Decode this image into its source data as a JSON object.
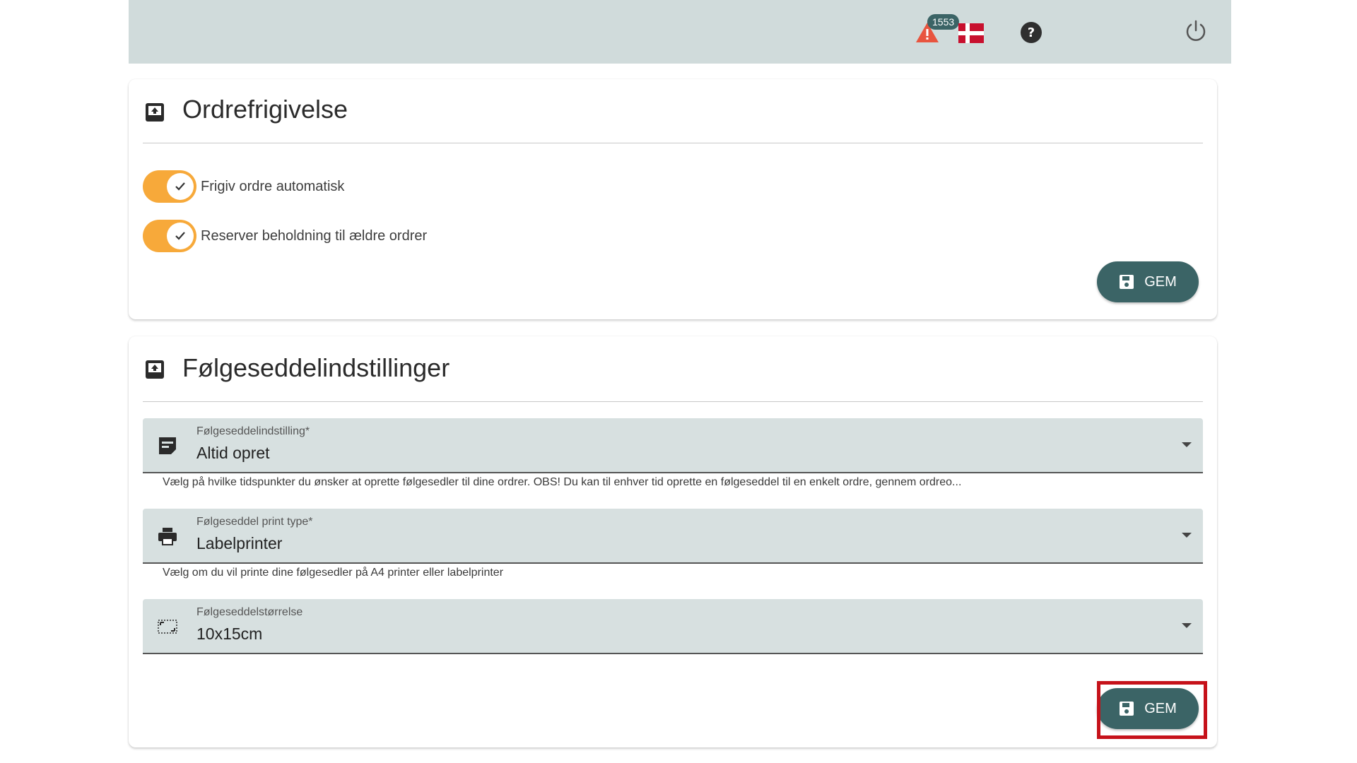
{
  "topbar": {
    "notification_count": "1553",
    "icons": [
      "warning-icon",
      "danish-flag-icon",
      "help-icon",
      "power-icon"
    ]
  },
  "order_release": {
    "title": "Ordrefrigivelse",
    "toggles": [
      {
        "label": "Frigiv ordre automatisk",
        "checked": true
      },
      {
        "label": "Reserver beholdning til ældre ordrer",
        "checked": true
      }
    ],
    "save_label": "GEM"
  },
  "packing_slip": {
    "title": "Følgeseddelindstillinger",
    "fields": [
      {
        "label": "Følgeseddelindstilling*",
        "value": "Altid opret",
        "icon": "note-icon",
        "hint": "Vælg på hvilke tidspunkter du ønsker at oprette følgesedler til dine ordrer. OBS! Du kan til enhver tid oprette en følgeseddel til en enkelt ordre, gennem ordreo..."
      },
      {
        "label": "Følgeseddel print type*",
        "value": "Labelprinter",
        "icon": "printer-icon",
        "hint": "Vælg om du vil printe dine følgesedler på A4 printer eller labelprinter"
      },
      {
        "label": "Følgeseddelstørrelse",
        "value": "10x15cm",
        "icon": "aspect-ratio-icon",
        "hint": ""
      }
    ],
    "save_label": "GEM"
  },
  "colors": {
    "topbar": "#d0dbdb",
    "primary": "#3b6466",
    "toggle_on": "#f7a93a",
    "field_bg": "#d7e0e0",
    "highlight": "#c6121a"
  }
}
